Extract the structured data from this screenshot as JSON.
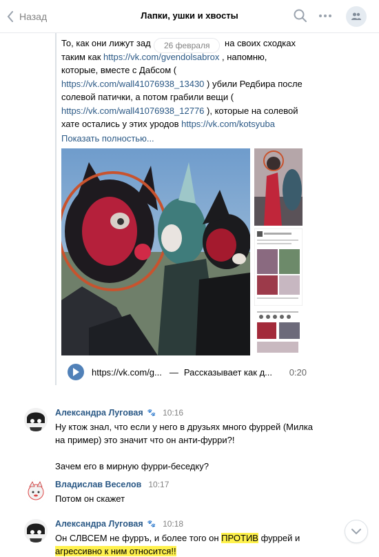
{
  "header": {
    "back_label": "Назад",
    "title": "Лапки, ушки и хвосты",
    "icons": [
      "chevron-left-icon",
      "search-icon",
      "more-icon",
      "group-avatar-icon"
    ]
  },
  "post": {
    "date_badge": "26 февраля",
    "lines": [
      {
        "text1": "То, как они лижут зад",
        "link": "",
        "text2": ""
      },
      {
        "text1": "таким как ",
        "link": "https://vk.com/gvendolsabrox",
        "text2": " , напомню,"
      }
    ],
    "line1_end": "на своих сходках",
    "line3": "которые, вместе с Дабсом (",
    "link_wall1": "https://vk.com/wall41076938_13430",
    "after_wall1": " ) убили Редбира после",
    "line5": "солевой патички, а потом грабили вещи (",
    "link_wall2": "https://vk.com/wall41076938_12776",
    "after_wall2": " ), которые на солевой",
    "line7_start": "хате остались у этих уродов ",
    "link_kots": "https://vk.com/kotsyuba",
    "show_full": "Показать полностью..."
  },
  "audio": {
    "link": "https://vk.com/g...",
    "dash": "—",
    "title": "Рассказывает как д...",
    "duration": "0:20"
  },
  "messages": [
    {
      "author": "Александра Луговая",
      "time": "10:16",
      "lines": [
        "Ну ктож знал, что если у него в друзьях много фуррей (Милка",
        "на пример) это значит что он анти-фурри?!",
        "",
        "Зачем его в мирную фурри-беседку?"
      ]
    },
    {
      "author": "Владислав Веселов",
      "time": "10:17",
      "lines": [
        "Потом он скажет"
      ]
    },
    {
      "author": "Александра Луговая",
      "time": "10:18",
      "part1": "Он СЛВСЕМ не фурръ, и более того он ",
      "highlight1": "ПРОТИВ",
      "part2": " фуррей и",
      "highlight2": "агрессивно к ним относится!!"
    }
  ],
  "colors": {
    "link": "#2a5885",
    "accent": "#5181b8",
    "highlight": "#fff24d",
    "muted": "#828282"
  }
}
